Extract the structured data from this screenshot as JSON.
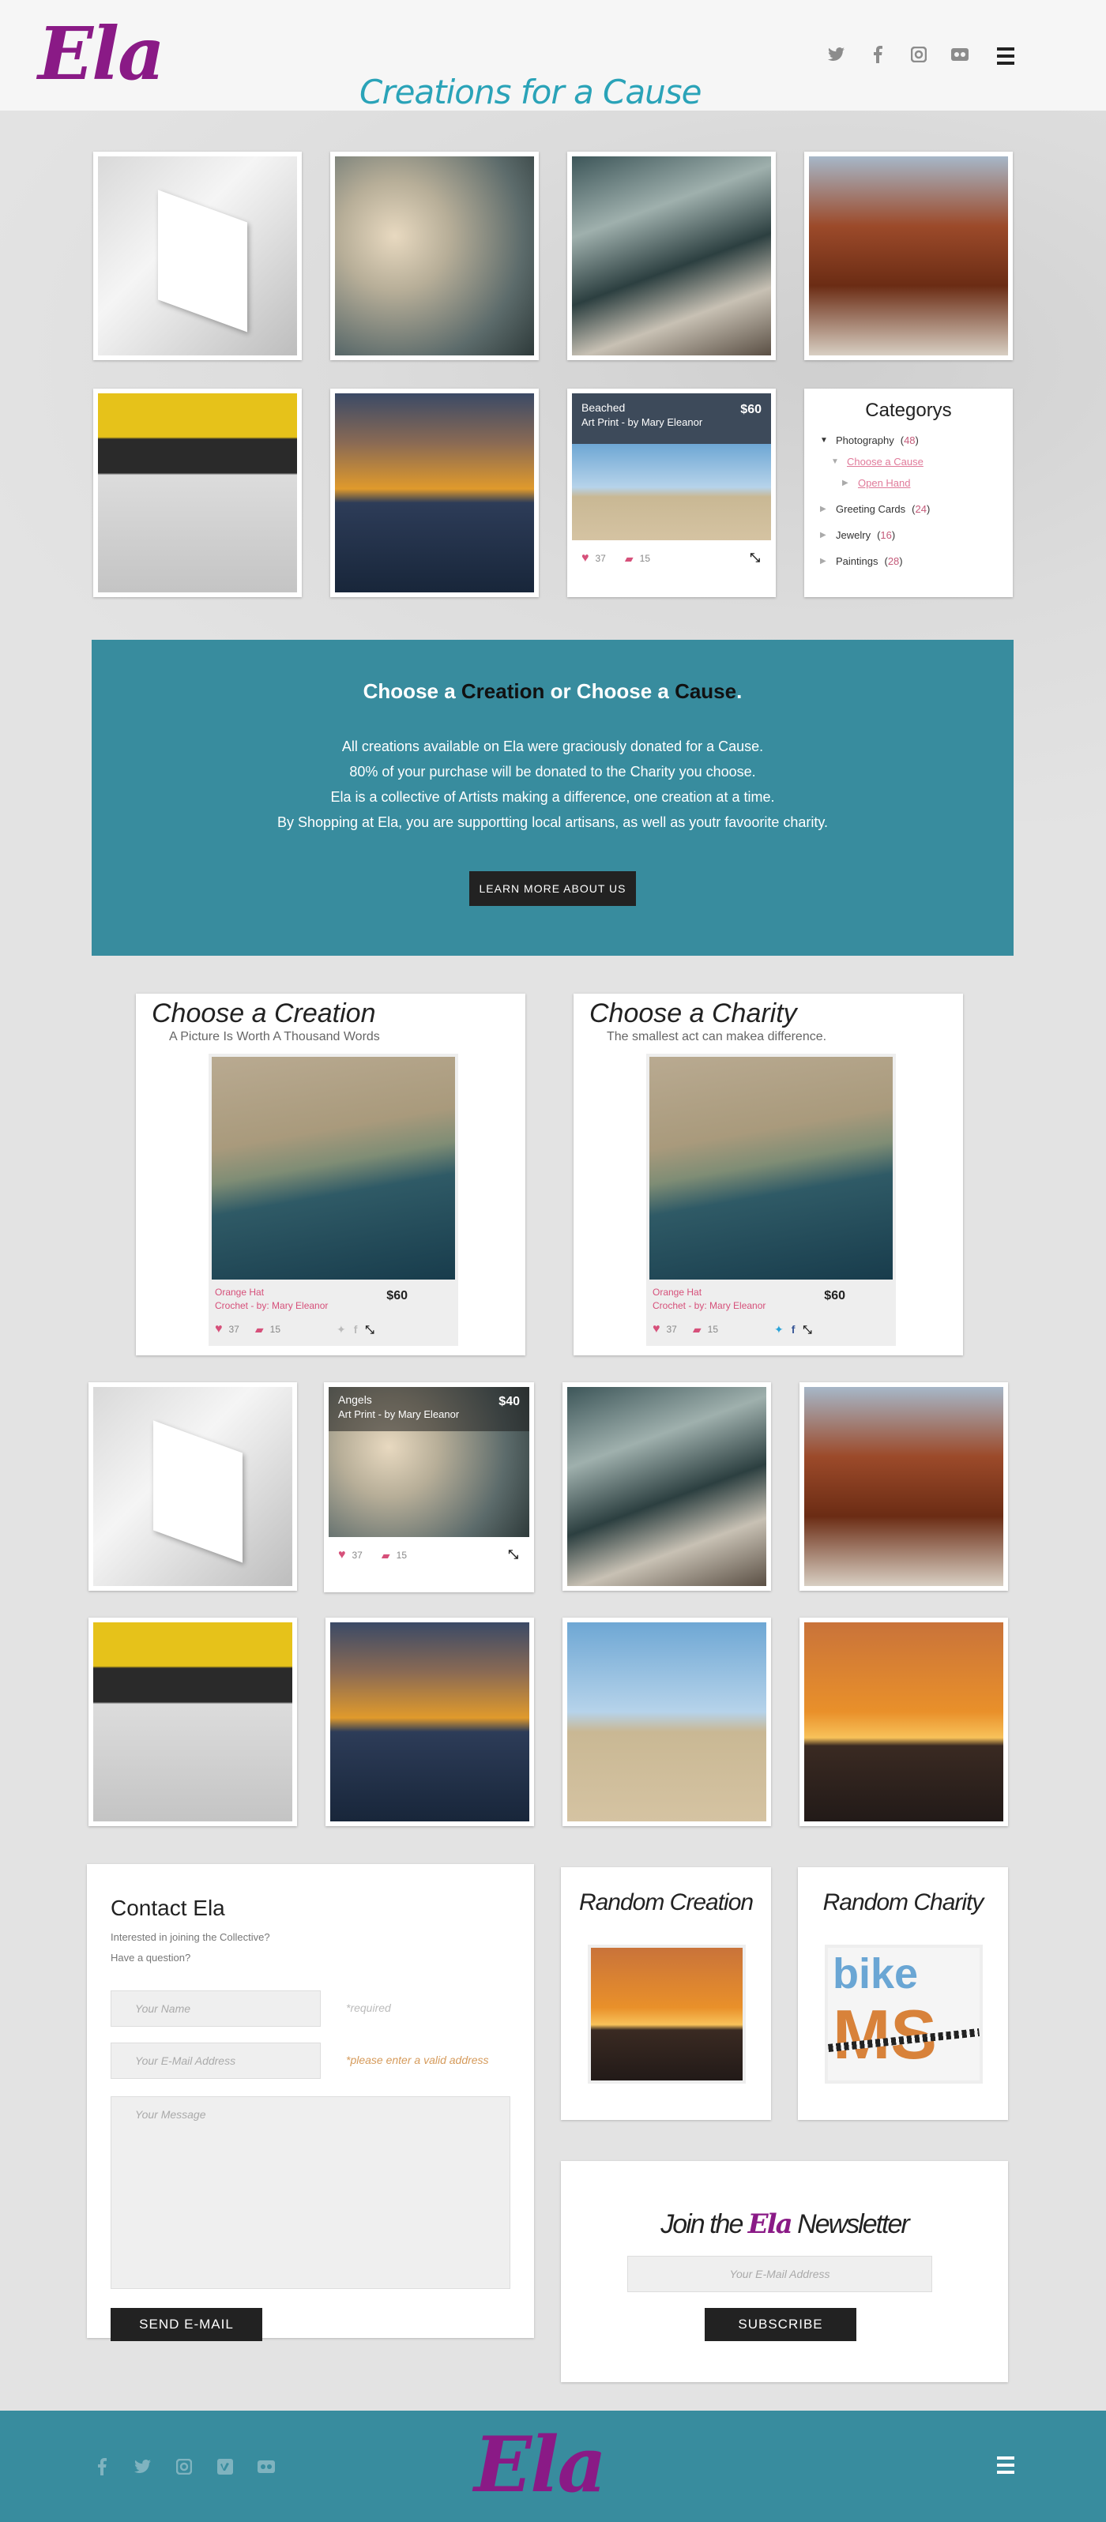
{
  "header": {
    "logo": "Ela",
    "tagline": "Creations for a Cause",
    "social": [
      "twitter-icon",
      "facebook-icon",
      "instagram-icon",
      "flickr-icon"
    ]
  },
  "gallery_top": {
    "beached": {
      "title": "Beached",
      "subtitle": "Art Print - by Mary Eleanor",
      "price": "$60",
      "likes": "37",
      "comments": "15"
    }
  },
  "categories": {
    "title": "Categorys",
    "items": [
      {
        "label": "Photography",
        "count": "48"
      },
      {
        "label": "Choose a Cause",
        "count": ""
      },
      {
        "label": "Open Hand",
        "count": ""
      },
      {
        "label": "Greeting Cards",
        "count": "24"
      },
      {
        "label": "Jewelry",
        "count": "16"
      },
      {
        "label": "Paintings",
        "count": "28"
      }
    ]
  },
  "banner": {
    "h_pre": "Choose a ",
    "h_creation": "Creation",
    "h_mid": " or Choose a ",
    "h_cause": "Cause",
    "h_end": ".",
    "line1": "All creations available on Ela were graciously donated for a Cause.",
    "line2": "80% of your purchase will be donated to the Charity you choose.",
    "line3": "Ela is a collective of Artists making a difference, one creation at a time.",
    "line4": "By Shopping at Ela, you are supportting local artisans, as well as youtr favoorite charity.",
    "button": "LEARN MORE ABOUT US"
  },
  "choose_creation": {
    "title": "Choose a Creation",
    "subtitle": "A Picture Is Worth A Thousand Words",
    "item_title": "Orange Hat",
    "item_sub": "Crochet - by: Mary Eleanor",
    "price": "$60",
    "likes": "37",
    "comments": "15"
  },
  "choose_charity": {
    "title": "Choose a Charity",
    "subtitle": "The smallest act can makea difference.",
    "item_title": "Orange Hat",
    "item_sub": "Crochet - by: Mary Eleanor",
    "price": "$60",
    "likes": "37",
    "comments": "15"
  },
  "gallery_bottom": {
    "angels": {
      "title": "Angels",
      "subtitle": "Art Print - by Mary Eleanor",
      "price": "$40",
      "likes": "37",
      "comments": "15"
    }
  },
  "contact": {
    "title": "Contact Ela",
    "intro1": "Interested in joining the Collective?",
    "intro2": "Have a question?",
    "name_placeholder": "Your Name",
    "name_hint": "*required",
    "email_placeholder": "Your E-Mail Address",
    "email_hint": "*please enter a valid address",
    "message_placeholder": "Your Message",
    "button": "SEND E-MAIL"
  },
  "random_creation": {
    "title": "Random Creation"
  },
  "random_charity": {
    "title": "Random Charity",
    "logo_top": "bike",
    "logo_bottom": "MS"
  },
  "newsletter": {
    "pre": "Join the ",
    "logo": "Ela",
    "post": " Newsletter",
    "placeholder": "Your E-Mail Address",
    "button": "SUBSCRIBE"
  },
  "footer": {
    "logo": "Ela",
    "social": [
      "facebook-icon",
      "twitter-icon",
      "instagram-icon",
      "vimeo-icon",
      "flickr-icon"
    ]
  },
  "colors": {
    "brand_purple": "#8a1a86",
    "teal": "#388c9e",
    "tagline": "#2aa3b8",
    "pink": "#d6507a"
  }
}
